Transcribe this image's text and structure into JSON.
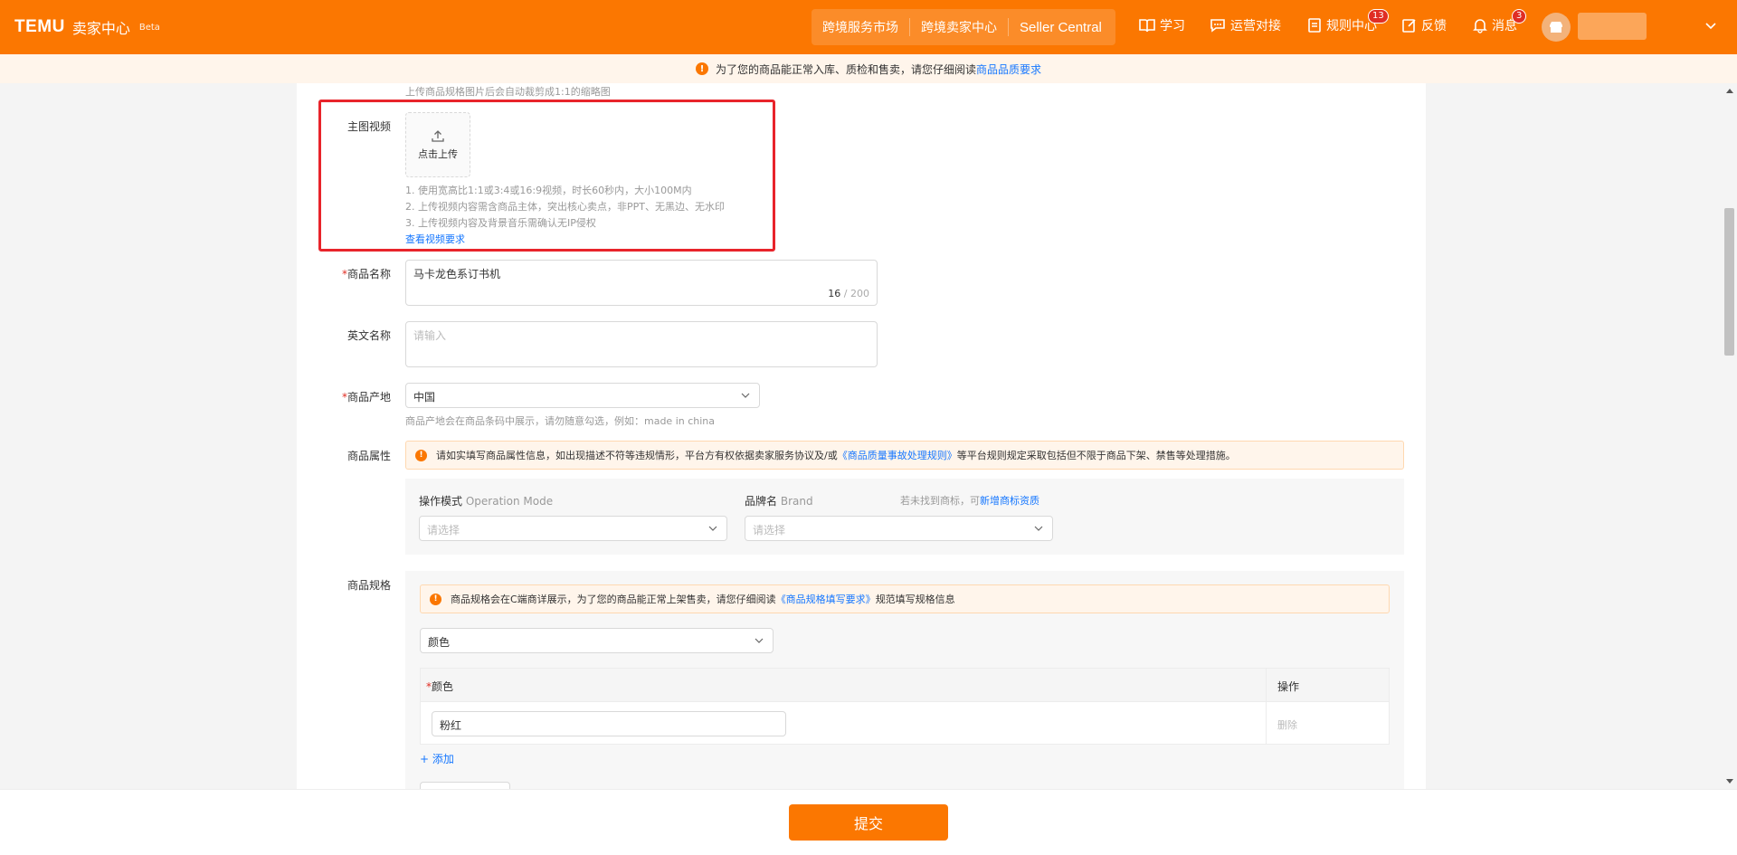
{
  "header": {
    "logo": "TEMU",
    "subtitle": "卖家中心",
    "beta": "Beta",
    "nav": [
      "跨境服务市场",
      "跨境卖家中心",
      "Seller Central"
    ],
    "tools": {
      "learn": "学习",
      "ops": "运营对接",
      "rules": "规则中心",
      "rules_badge": "13",
      "feedback": "反馈",
      "messages": "消息",
      "messages_badge": "3"
    }
  },
  "notice": {
    "text": "为了您的商品能正常入库、质检和售卖，请您仔细阅读",
    "link": "商品品质要求"
  },
  "form": {
    "image_hint": "上传商品规格图片后会自动裁剪成1:1的缩略图",
    "video": {
      "label": "主图视频",
      "upload": "点击上传",
      "rules": [
        "1. 使用宽高比1:1或3:4或16:9视频，时长60秒内，大小100M内",
        "2. 上传视频内容需含商品主体，突出核心卖点，非PPT、无黑边、无水印",
        "3. 上传视频内容及背景音乐需确认无IP侵权"
      ],
      "link": "查看视频要求"
    },
    "name": {
      "label": "商品名称",
      "value": "马卡龙色系订书机",
      "count": "16",
      "max": "/ 200"
    },
    "en_name": {
      "label": "英文名称",
      "placeholder": "请输入"
    },
    "origin": {
      "label": "商品产地",
      "value": "中国",
      "hint": "商品产地会在商品条码中展示，请勿随意勾选，例如：made in china"
    },
    "attrs": {
      "label": "商品属性",
      "warning_pre": "请如实填写商品属性信息，如出现描述不符等违规情形，平台方有权依据卖家服务协议及/或",
      "warning_link": "《商品质量事故处理规则》",
      "warning_post": "等平台规则规定采取包括但不限于商品下架、禁售等处理措施。",
      "mode_label": "操作模式",
      "mode_en": "Operation Mode",
      "mode_placeholder": "请选择",
      "brand_label": "品牌名",
      "brand_en": "Brand",
      "brand_hint": "若未找到商标，可",
      "brand_link": "新增商标资质",
      "brand_placeholder": "请选择"
    },
    "spec": {
      "label": "商品规格",
      "warning_pre": "商品规格会在C端商详展示，为了您的商品能正常上架售卖，请您仔细阅读",
      "warning_link": "《商品规格填写要求》",
      "warning_post": "规范填写规格信息",
      "type_value": "颜色",
      "col_color": "颜色",
      "col_action": "操作",
      "row_value": "粉红",
      "row_action": "删除",
      "add": "+ 添加"
    }
  },
  "footer": {
    "submit": "提交"
  },
  "colors": {
    "brand": "#fb7701",
    "highlight": "#e8242b",
    "link": "#1677ff"
  }
}
